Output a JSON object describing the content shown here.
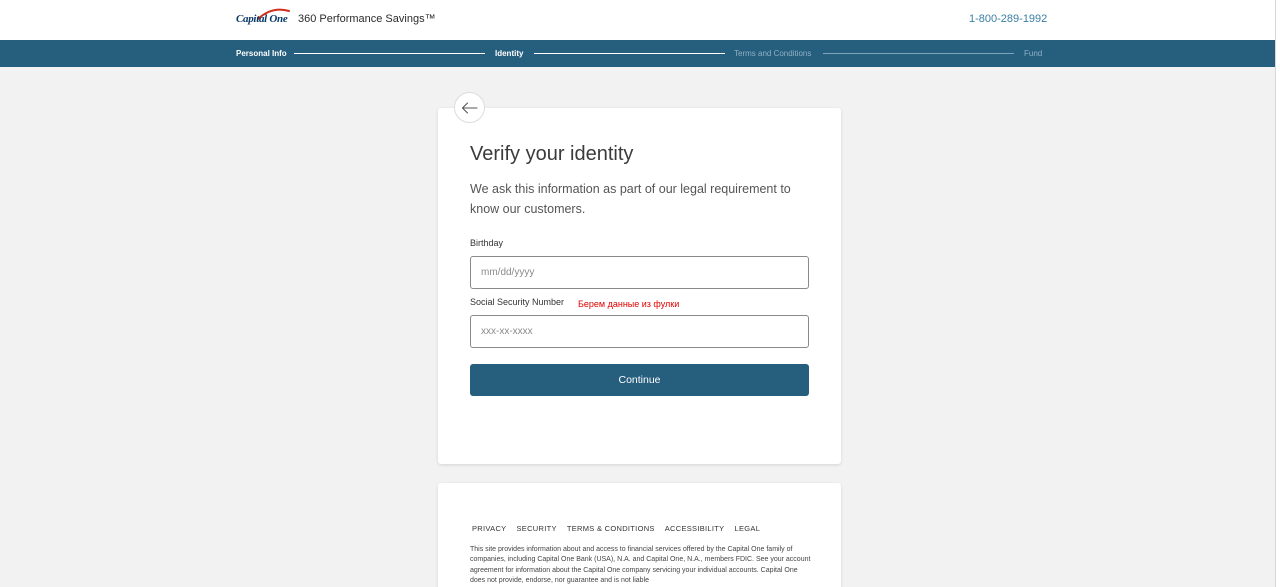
{
  "header": {
    "logo_text": "Capital One",
    "product_title": "360 Performance Savings™",
    "phone": "1-800-289-1992"
  },
  "progress": {
    "steps": [
      {
        "label": "Personal Info",
        "state": "complete"
      },
      {
        "label": "Identity",
        "state": "current"
      },
      {
        "label": "Terms and Conditions",
        "state": "upcoming"
      },
      {
        "label": "Fund",
        "state": "upcoming"
      }
    ]
  },
  "card": {
    "title": "Verify your identity",
    "subtitle": "We ask this information as part of our legal requirement to know our customers.",
    "birthday_label": "Birthday",
    "birthday_placeholder": "mm/dd/yyyy",
    "ssn_label": "Social Security Number",
    "ssn_placeholder": "xxx-xx-xxxx",
    "annotation": "Берем данные из фулки",
    "continue_label": "Continue"
  },
  "footer": {
    "links": [
      "PRIVACY",
      "SECURITY",
      "TERMS & CONDITIONS",
      "ACCESSIBILITY",
      "LEGAL"
    ],
    "disclaimer": "This site provides information about and access to financial services offered by the Capital One family of companies, including Capital One Bank (USA), N.A. and Capital One, N.A., members FDIC. See your account agreement for information about the Capital One company servicing your individual accounts. Capital One does not provide, endorse, nor guarantee and is not liable"
  },
  "colors": {
    "brand_blue": "#265e7e",
    "page_background": "#f2f2f2",
    "phone_link": "#3a7ea3",
    "annotation_red": "#e00000"
  },
  "icons": {
    "back": "arrow-left-icon",
    "logo": "capital-one-swoosh-icon"
  }
}
